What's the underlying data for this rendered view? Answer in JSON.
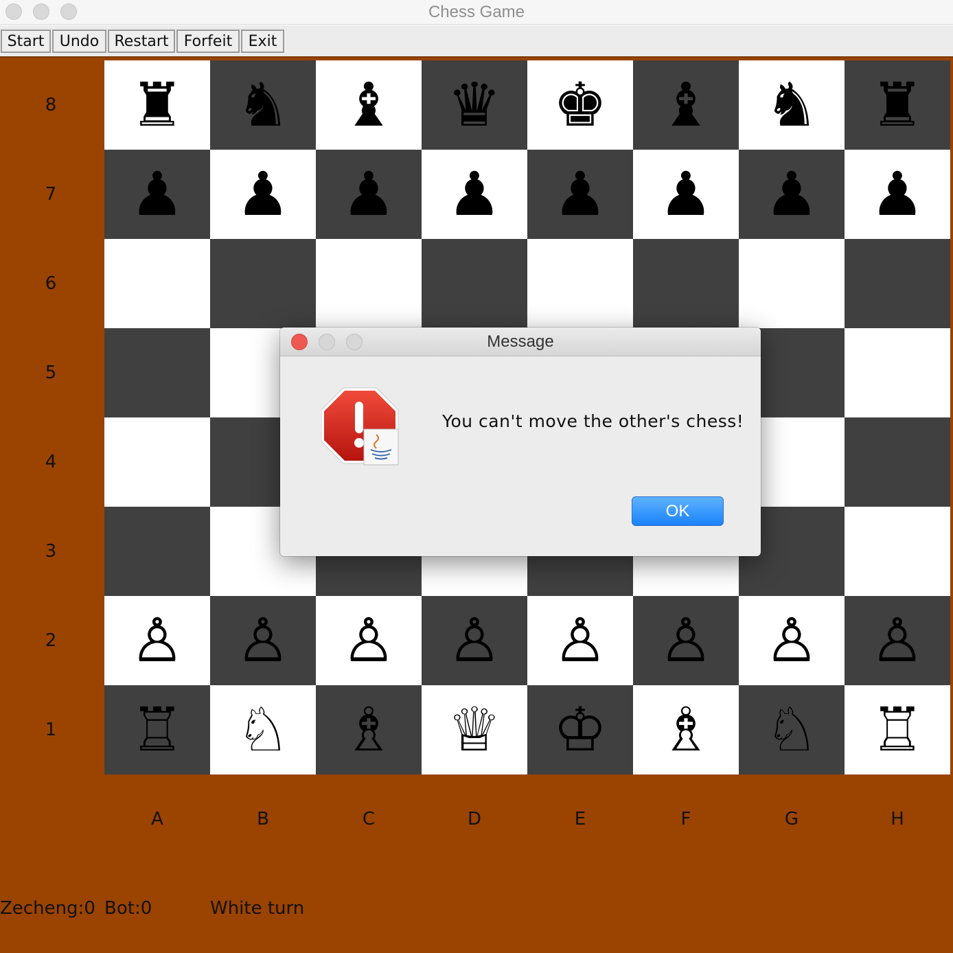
{
  "window": {
    "title": "Chess Game"
  },
  "menubar": {
    "buttons": [
      "Start",
      "Undo",
      "Restart",
      "Forfeit",
      "Exit"
    ]
  },
  "board": {
    "ranks": [
      "8",
      "7",
      "6",
      "5",
      "4",
      "3",
      "2",
      "1"
    ],
    "files": [
      "A",
      "B",
      "C",
      "D",
      "E",
      "F",
      "G",
      "H"
    ],
    "colors": {
      "light_square": "#ffffff",
      "dark_square": "#404040",
      "background": "#9b4300"
    },
    "rows": [
      [
        "♜",
        "♞",
        "♝",
        "♛",
        "♚",
        "♝",
        "♞",
        "♜"
      ],
      [
        "♟",
        "♟",
        "♟",
        "♟",
        "♟",
        "♟",
        "♟",
        "♟"
      ],
      [
        "",
        "",
        "",
        "",
        "",
        "",
        "",
        ""
      ],
      [
        "",
        "",
        "",
        "",
        "",
        "",
        "",
        ""
      ],
      [
        "",
        "",
        "",
        "",
        "",
        "",
        "",
        ""
      ],
      [
        "",
        "",
        "",
        "",
        "",
        "",
        "",
        ""
      ],
      [
        "♙",
        "♙",
        "♙",
        "♙",
        "♙",
        "♙",
        "♙",
        "♙"
      ],
      [
        "♖",
        "♘",
        "♗",
        "♕",
        "♔",
        "♗",
        "♘",
        "♖"
      ]
    ]
  },
  "status": {
    "player_score": "Zecheng:0",
    "bot_score": "Bot:0",
    "turn": "White turn"
  },
  "dialog": {
    "title": "Message",
    "message": "You can't move the other's chess!",
    "ok_label": "OK",
    "icon": "stop-warning-icon"
  }
}
